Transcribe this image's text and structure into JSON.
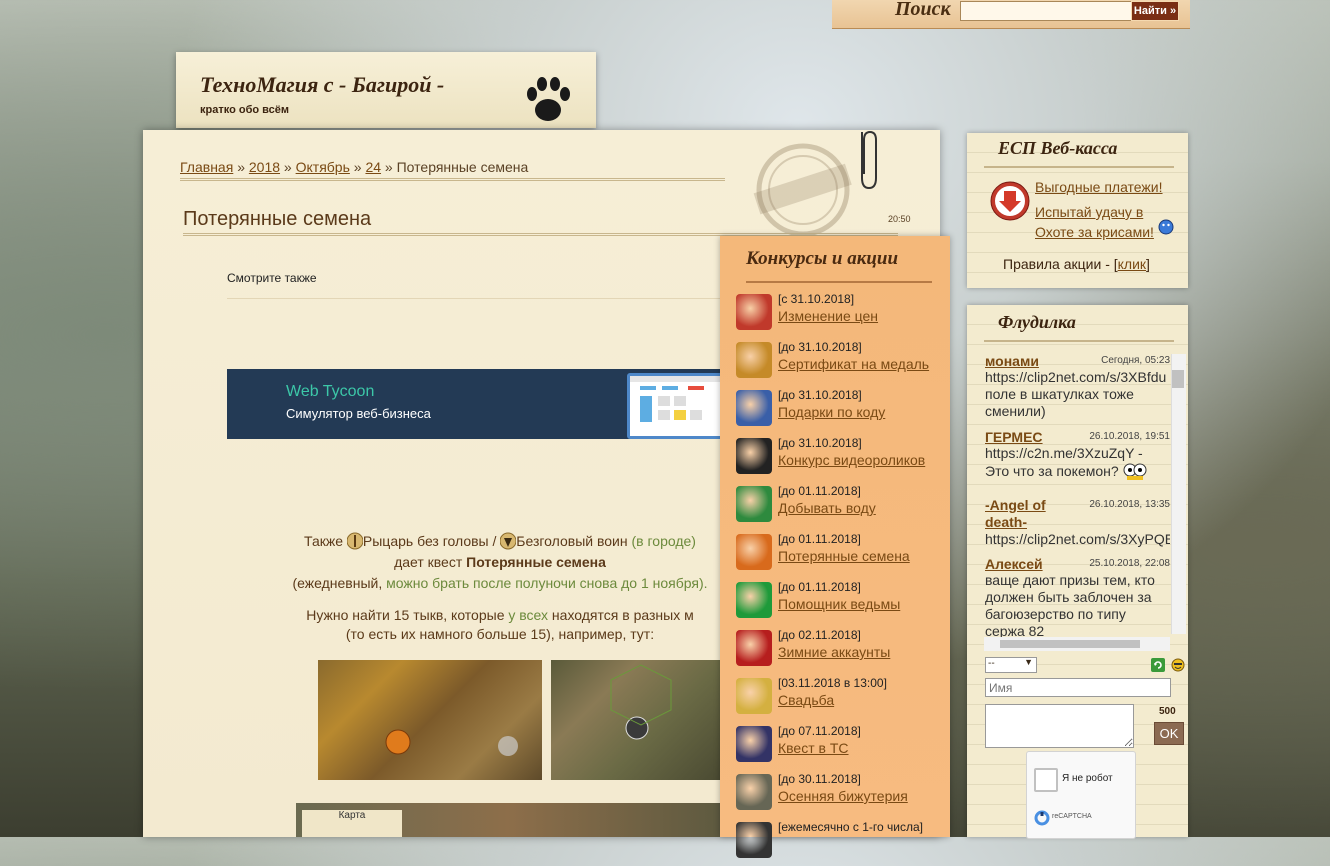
{
  "search": {
    "label": "Поиск",
    "placeholder": "",
    "button": "Найти »"
  },
  "header": {
    "title": "ТехноМагия с - Багирой -",
    "tagline": "кратко обо всём"
  },
  "breadcrumb": {
    "home": "Главная",
    "year": "2018",
    "month": "Октябрь",
    "day": "24",
    "sep": "»",
    "current": "Потерянные семена"
  },
  "post": {
    "title": "Потерянные семена",
    "time": "20:50",
    "see_also": "Смотрите также",
    "p1_a": "Также ",
    "npc1": "Рыцарь без головы",
    "p1_slash": " / ",
    "npc2": "Безголовый воин",
    "p1_city": "(в городе)",
    "p1_b": "дает квест ",
    "quest": "Потерянные семена",
    "p1_c": "(ежедневный, ",
    "p1_d": "можно брать после полуночи снова до 1 ноября).",
    "p2_a": "Нужно найти 15 тыкв, которые ",
    "p2_b": "у всех",
    "p2_c": " находятся в разных м",
    "p2_d": "(то есть их намного больше 15), например, тут:",
    "map_label": "Карта"
  },
  "ad": {
    "title": "Web Tycoon",
    "subtitle": "Симулятор веб-бизнеса"
  },
  "contests": {
    "title": "Конкурсы и акции",
    "items": [
      {
        "date": "[с 31.10.2018]",
        "label": "Изменение цен",
        "color": "#c0392b"
      },
      {
        "date": "[до 31.10.2018]",
        "label": "Сертификат на медаль",
        "color": "#c58a28"
      },
      {
        "date": "[до 31.10.2018]",
        "label": "Подарки по коду",
        "color": "#3a5fa8"
      },
      {
        "date": "[до 31.10.2018]",
        "label": "Конкурс видеороликов",
        "color": "#222222"
      },
      {
        "date": "[до 01.11.2018]",
        "label": "Добывать воду",
        "color": "#2e8a3e"
      },
      {
        "date": "[до 01.11.2018]",
        "label": "Потерянные семена",
        "color": "#d86a1c"
      },
      {
        "date": "[до 01.11.2018]",
        "label": "Помощник ведьмы",
        "color": "#1e9a3a"
      },
      {
        "date": "[до 02.11.2018]",
        "label": "Зимние аккаунты",
        "color": "#b61e1e"
      },
      {
        "date": "[03.11.2018 в 13:00]",
        "label": "Свадьба",
        "color": "#d4b040"
      },
      {
        "date": "[до 07.11.2018]",
        "label": "Квест в ТС",
        "color": "#333366"
      },
      {
        "date": "[до 30.11.2018]",
        "label": "Осенняя бижутерия",
        "color": "#666655"
      },
      {
        "date": "[ежемесячно с 1-го числа]",
        "label": "",
        "color": "#333333"
      }
    ]
  },
  "ecp": {
    "title": "ЕСП Веб-касса",
    "link1": "Выгодные платежи!",
    "link2": "Испытай удачу в Охоте за крисами!",
    "rules_prefix": "Правила акции - [",
    "rules_link": "клик",
    "rules_suffix": "]"
  },
  "flood": {
    "title": "Флудилка",
    "messages": [
      {
        "user": "монами",
        "time": "Сегодня, 05:23",
        "lines": [
          "https://clip2net.com/s/3XBfdu",
          "поле в шкатулках тоже",
          "сменили)"
        ]
      },
      {
        "user": "ГЕРМЕС",
        "time": "26.10.2018, 19:51",
        "lines": [
          "https://c2n.me/3XzuZqY -",
          "Это что за покемон?"
        ]
      },
      {
        "user": "-Angel of death-",
        "time": "26.10.2018, 13:35",
        "lines": [
          "https://clip2net.com/s/3XyPQE"
        ]
      },
      {
        "user": "Алексей",
        "time": "25.10.2018, 22:08",
        "lines": [
          "ваще дают призы тем, кто",
          "должен быть заблочен за",
          "багоюзерство по типу",
          "сержа 82"
        ]
      }
    ],
    "select_value": "--",
    "name_placeholder": "Имя",
    "char_count": "500",
    "ok": "OK",
    "captcha_text": "Я не робот",
    "captcha_brand": "reCAPTCHA"
  }
}
